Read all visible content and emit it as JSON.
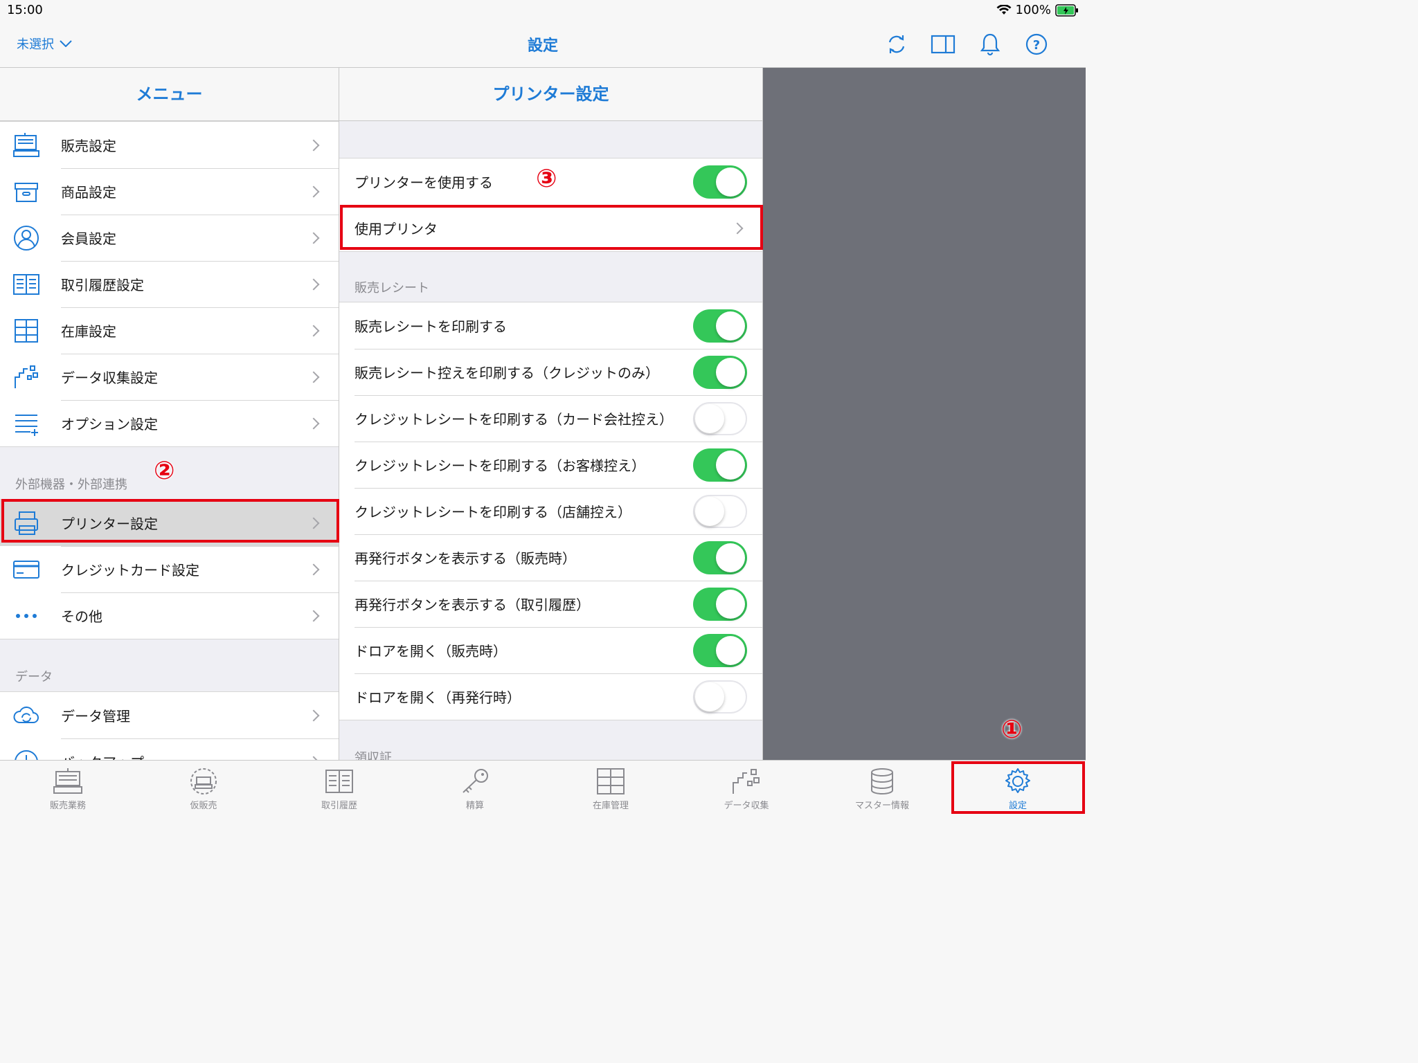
{
  "status": {
    "time": "15:00",
    "battery": "100%"
  },
  "nav": {
    "store": "未選択",
    "title": "設定"
  },
  "menu": {
    "header": "メニュー",
    "items": [
      {
        "label": "販売設定",
        "icon": "register-icon"
      },
      {
        "label": "商品設定",
        "icon": "box-icon"
      },
      {
        "label": "会員設定",
        "icon": "person-icon"
      },
      {
        "label": "取引履歴設定",
        "icon": "book-icon"
      },
      {
        "label": "在庫設定",
        "icon": "shelf-icon"
      },
      {
        "label": "データ収集設定",
        "icon": "data-collect-icon"
      },
      {
        "label": "オプション設定",
        "icon": "option-list-icon"
      }
    ],
    "external_section": "外部機器・外部連携",
    "external_items": [
      {
        "label": "プリンター設定",
        "icon": "printer-icon"
      },
      {
        "label": "クレジットカード設定",
        "icon": "credit-card-icon"
      },
      {
        "label": "その他",
        "icon": "more-icon"
      }
    ],
    "data_section": "データ",
    "data_items": [
      {
        "label": "データ管理",
        "icon": "cloud-sync-icon"
      },
      {
        "label": "バックアップ",
        "icon": "clock-icon"
      }
    ]
  },
  "printer": {
    "header": "プリンター設定",
    "use_printer": {
      "label": "プリンターを使用する",
      "on": true
    },
    "printer_select": "使用プリンタ",
    "receipt_section": "販売レシート",
    "toggles": [
      {
        "label": "販売レシートを印刷する",
        "on": true
      },
      {
        "label": "販売レシート控えを印刷する（クレジットのみ）",
        "on": true
      },
      {
        "label": "クレジットレシートを印刷する（カード会社控え）",
        "on": false
      },
      {
        "label": "クレジットレシートを印刷する（お客様控え）",
        "on": true
      },
      {
        "label": "クレジットレシートを印刷する（店舗控え）",
        "on": false
      },
      {
        "label": "再発行ボタンを表示する（販売時）",
        "on": true
      },
      {
        "label": "再発行ボタンを表示する（取引履歴）",
        "on": true
      },
      {
        "label": "ドロアを開く（販売時）",
        "on": true
      },
      {
        "label": "ドロアを開く（再発行時）",
        "on": false
      }
    ],
    "next_section": "領収証"
  },
  "annotations": {
    "one": "①",
    "two": "②",
    "three": "③"
  },
  "tabs": [
    {
      "label": "販売業務",
      "icon": "register-icon"
    },
    {
      "label": "仮販売",
      "icon": "temp-sale-icon"
    },
    {
      "label": "取引履歴",
      "icon": "book-icon"
    },
    {
      "label": "精算",
      "icon": "key-icon"
    },
    {
      "label": "在庫管理",
      "icon": "shelf-icon"
    },
    {
      "label": "データ収集",
      "icon": "data-collect-icon"
    },
    {
      "label": "マスター情報",
      "icon": "database-icon"
    },
    {
      "label": "設定",
      "icon": "gear-icon"
    }
  ],
  "colors": {
    "accent": "#1e7bd6",
    "toggle_on": "#34c759",
    "annotation": "#e60012"
  }
}
